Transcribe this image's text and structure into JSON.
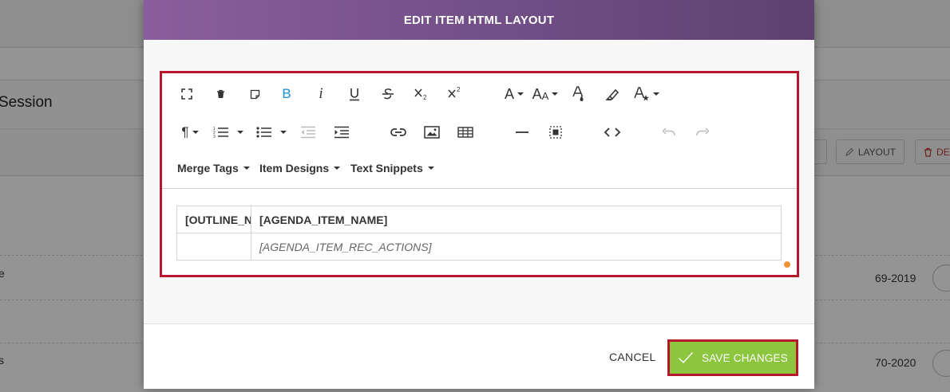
{
  "background": {
    "page_title_fragment": "Session",
    "buttons": {
      "layout": "LAYOUT",
      "delete_fragment": "DE"
    },
    "rows": [
      {
        "left_fragment": "e",
        "right_value": "69-2019"
      },
      {
        "left_fragment": "s",
        "right_value": "70-2020"
      }
    ]
  },
  "modal": {
    "title": "EDIT ITEM HTML LAYOUT",
    "toolbar": {
      "dropdowns": {
        "merge_tags": "Merge Tags",
        "item_designs": "Item Designs",
        "text_snippets": "Text Snippets"
      }
    },
    "content": {
      "rows": [
        [
          "[OUTLINE_NUMBER]",
          "[AGENDA_ITEM_NAME]"
        ],
        [
          "",
          "[AGENDA_ITEM_REC_ACTIONS]"
        ]
      ]
    },
    "footer": {
      "cancel": "CANCEL",
      "save": "SAVE CHANGES"
    }
  },
  "colors": {
    "header_gradient_start": "#8a5e9c",
    "header_gradient_end": "#5e4170",
    "highlight_border": "#b8182d",
    "save_button": "#8cc63f",
    "bold_active": "#1a8fd6",
    "resize_handle": "#f0943a"
  }
}
